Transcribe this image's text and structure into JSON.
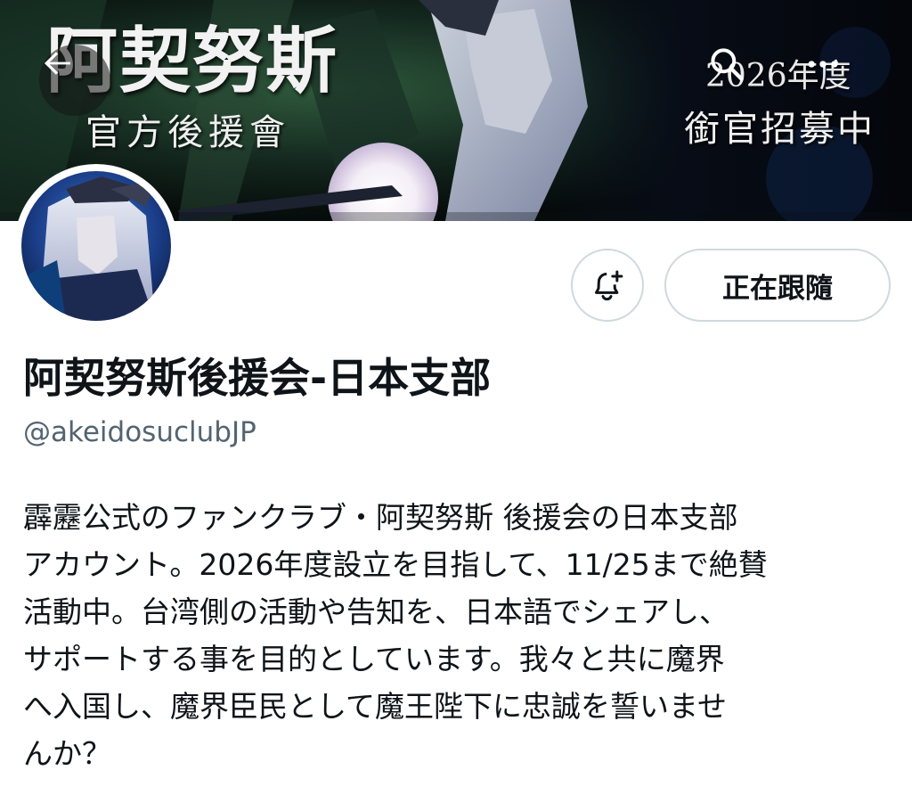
{
  "banner": {
    "title": "阿契努斯",
    "subtitle": "官方後援會",
    "year": "2026年度",
    "recruit": "銜官招募中"
  },
  "nav": {
    "back_icon": "arrow-left-icon",
    "search_icon": "search-icon",
    "more_icon": "more-icon"
  },
  "profile": {
    "display_name": "阿契努斯後援会-日本支部",
    "handle": "@akeidosuclubJP",
    "bio_lines": [
      "霹靂公式のファンクラブ・阿契努斯 後援会の日本支部",
      "アカウント。2026年度設立を目指して、11/25まで絶賛",
      "活動中。台湾側の活動や告知を、日本語でシェアし、",
      "サポートする事を目的としています。我々と共に魔界",
      "へ入国し、魔界臣民として魔王陛下に忠誠を誓いませ",
      "んか？"
    ]
  },
  "actions": {
    "notify_icon": "bell-plus-icon",
    "follow_label": "正在跟隨"
  },
  "colors": {
    "text_primary": "#0f1419",
    "text_secondary": "#536471",
    "border": "#cfd9de"
  }
}
